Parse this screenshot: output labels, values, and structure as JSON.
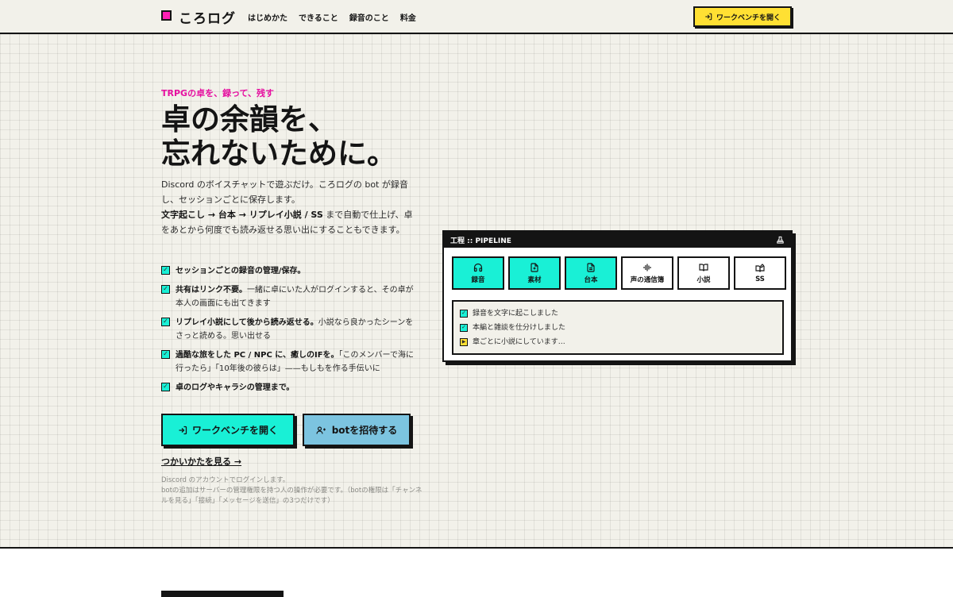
{
  "header": {
    "logo": "ころログ",
    "nav": [
      "はじめかた",
      "できること",
      "録音のこと",
      "料金"
    ],
    "cta": "ワークベンチを開く"
  },
  "hero": {
    "eyebrow": "TRPGの卓を、録って、残す",
    "title_line1": "卓の余韻を、",
    "title_line2": "忘れないために。",
    "lead_1": "Discord のボイスチャットで遊ぶだけ。ころログの bot が録音し、セッションごとに保存します。",
    "lead_2_bold": "文字起こし → 台本 → リプレイ小説 / SS",
    "lead_2_rest": " まで自動で仕上げ、卓をあとから何度でも読み返せる思い出にすることもできます。",
    "features": [
      {
        "bold": "セッションごとの録音の管理/保存。",
        "rest": ""
      },
      {
        "bold": "共有はリンク不要。",
        "rest": "一緒に卓にいた人がログインすると、その卓が本人の画面にも出てきます"
      },
      {
        "bold": "リプレイ小説にして後から読み返せる。",
        "rest": "小説なら良かったシーンをさっと読める。思い出せる"
      },
      {
        "bold": "過酷な旅をした PC / NPC に、癒しのIFを。",
        "rest": "「このメンバーで海に行ったら」「10年後の彼らは」——もしもを作る手伝いに"
      },
      {
        "bold": "卓のログやキャラシの管理まで。",
        "rest": ""
      }
    ],
    "btn_primary": "ワークベンチを開く",
    "btn_secondary": "botを招待する",
    "howto": "つかいかたを見る →",
    "note_1": "Discord のアカウントでログインします。",
    "note_2": "botの追加はサーバーの管理権限を持つ人の操作が必要です。（botの権限は「チャンネルを見る」「接続」「メッセージを送信」の3つだけです）"
  },
  "pipeline": {
    "title": "工程 :: PIPELINE",
    "steps": [
      {
        "label": "録音",
        "icon": "headphones-icon",
        "done": true
      },
      {
        "label": "素材",
        "icon": "file-plus-icon",
        "done": true
      },
      {
        "label": "台本",
        "icon": "file-text-icon",
        "done": true
      },
      {
        "label": "声の通信簿",
        "icon": "audio-wave-icon",
        "done": false
      },
      {
        "label": "小説",
        "icon": "book-open-icon",
        "done": false
      },
      {
        "label": "SS",
        "icon": "book-pen-icon",
        "done": false
      }
    ],
    "log": [
      {
        "text": "録音を文字に起こしました",
        "status": "done"
      },
      {
        "text": "本編と雑談を仕分けしました",
        "status": "done"
      },
      {
        "text": "章ごとに小説にしています…",
        "status": "running"
      }
    ]
  },
  "colors": {
    "accent_cyan": "#19f0d6",
    "accent_yellow": "#ffe033",
    "accent_pink": "#ff1fb4",
    "accent_blue": "#7cc4e0",
    "ink": "#141414",
    "paper": "#f2f1ea"
  }
}
